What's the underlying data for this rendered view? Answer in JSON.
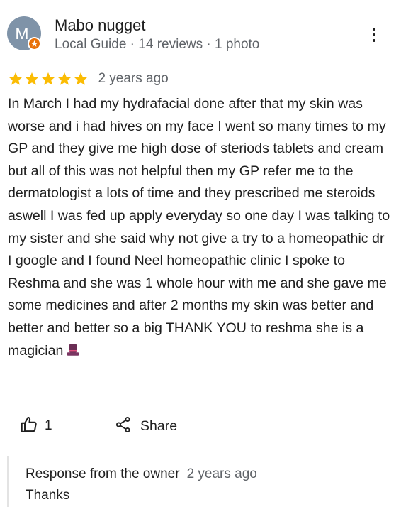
{
  "reviewer": {
    "initial": "M",
    "name": "Mabo nugget",
    "meta": "Local Guide · 14 reviews · 1 photo",
    "badge_icon": "local-guide-star-icon",
    "avatar_color": "#7f93a8",
    "badge_color": "#e8710a"
  },
  "menu": {
    "icon": "more-vertical-icon"
  },
  "review": {
    "rating": 5,
    "rating_max": 5,
    "star_color": "#fbbc04",
    "date": "2 years ago",
    "text": "In March I had my hydrafacial done after that my skin was worse and i had hives on my face I went so many times to my GP and they give me high dose of steriods tablets and cream but all of this was not helpful then my GP refer me to the dermatologist a lots of time and they prescribed me steroids aswell I was fed up apply everyday so one day I was talking to my sister and she said why not give a try to a homeopathic dr I google and I found Neel homeopathic clinic I spoke to Reshma and she was 1 whole hour with me and she gave me some medicines and after 2 months my skin was better and better and better so a big THANK YOU to reshma she is a magician",
    "emoji": "top-hat-emoji"
  },
  "actions": {
    "like_icon": "thumbs-up-icon",
    "like_count": "1",
    "share_icon": "share-icon",
    "share_label": "Share"
  },
  "owner_response": {
    "title": "Response from the owner",
    "date": "2 years ago",
    "text": "Thanks"
  }
}
